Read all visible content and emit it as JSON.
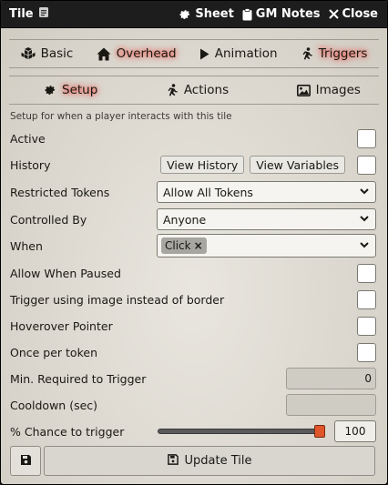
{
  "window": {
    "title": "Tile",
    "header_buttons": [
      {
        "label": "Sheet",
        "icon": "gear-icon"
      },
      {
        "label": "GM Notes",
        "icon": "clipboard-icon"
      },
      {
        "label": "Close",
        "icon": "close-icon"
      }
    ]
  },
  "primary_tabs": [
    {
      "label": "Basic",
      "icon": "cubes-icon",
      "active": false
    },
    {
      "label": "Overhead",
      "icon": "home-icon",
      "active": true
    },
    {
      "label": "Animation",
      "icon": "play-icon",
      "active": false
    },
    {
      "label": "Triggers",
      "icon": "running-icon",
      "active": true
    }
  ],
  "secondary_tabs": [
    {
      "label": "Setup",
      "icon": "gear-icon",
      "active": true
    },
    {
      "label": "Actions",
      "icon": "running-icon",
      "active": false
    },
    {
      "label": "Images",
      "icon": "image-icon",
      "active": false
    }
  ],
  "setup_note": "Setup for when a player interacts with this tile",
  "fields": {
    "active": {
      "label": "Active",
      "checked": false
    },
    "history": {
      "label": "History",
      "view_history": "View History",
      "view_variables": "View Variables",
      "checked": false
    },
    "restricted_tokens": {
      "label": "Restricted Tokens",
      "value": "Allow All Tokens"
    },
    "controlled_by": {
      "label": "Controlled By",
      "value": "Anyone"
    },
    "when": {
      "label": "When",
      "chip": "Click",
      "chip_remove": "×"
    },
    "allow_when_paused": {
      "label": "Allow When Paused",
      "checked": false
    },
    "trigger_using_image": {
      "label": "Trigger using image instead of border",
      "checked": false
    },
    "hoverover_pointer": {
      "label": "Hoverover Pointer",
      "checked": false
    },
    "once_per_token": {
      "label": "Once per token",
      "checked": false
    },
    "min_required": {
      "label": "Min. Required to Trigger",
      "value": "0"
    },
    "cooldown": {
      "label": "Cooldown (sec)",
      "value": ""
    },
    "chance": {
      "label": "% Chance to trigger",
      "value": "100",
      "fraction": 1.0
    }
  },
  "footer": {
    "update_label": "Update Tile"
  },
  "colors": {
    "accent": "#e0552a",
    "titlebar": "#1d1d1d",
    "panel": "#ddd9d1"
  }
}
